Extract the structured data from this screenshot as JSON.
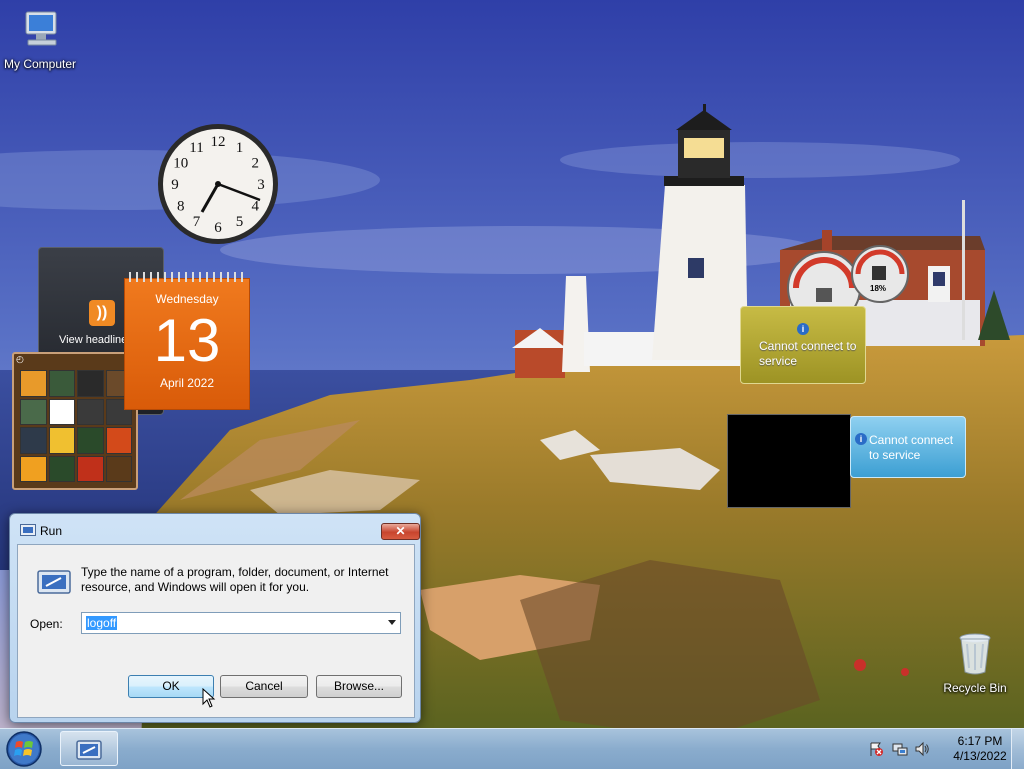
{
  "desktop": {
    "icons": [
      {
        "label": "My Computer"
      },
      {
        "label": "Recycle Bin"
      }
    ]
  },
  "gadgets": {
    "feed": {
      "label": "View headlines"
    },
    "calendar": {
      "weekday": "Wednesday",
      "day": "13",
      "month_year": "April 2022"
    },
    "weather_small": {
      "message": "Cannot connect to service"
    },
    "weather_wide": {
      "message": "Cannot connect to service"
    },
    "meter": {
      "percent": "18%"
    },
    "clock": {
      "numerals": [
        "12",
        "1",
        "2",
        "3",
        "4",
        "5",
        "6",
        "7",
        "8",
        "9",
        "10",
        "11"
      ]
    }
  },
  "run_dialog": {
    "title": "Run",
    "description": "Type the name of a program, folder, document, or Internet resource, and Windows will open it for you.",
    "open_label": "Open:",
    "open_value": "logoff",
    "ok_label": "OK",
    "cancel_label": "Cancel",
    "browse_label": "Browse...",
    "close_glyph": "✕"
  },
  "taskbar": {
    "clock_time": "6:17 PM",
    "clock_date": "4/13/2022",
    "tray_icons": [
      "action-center-icon",
      "network-icon",
      "volume-icon"
    ]
  },
  "colors": {
    "calendar_orange": "#e8690f",
    "weather_yellow": "#b3a834",
    "weather_blue": "#5fb6e2",
    "taskbar": "#8aaccd"
  }
}
